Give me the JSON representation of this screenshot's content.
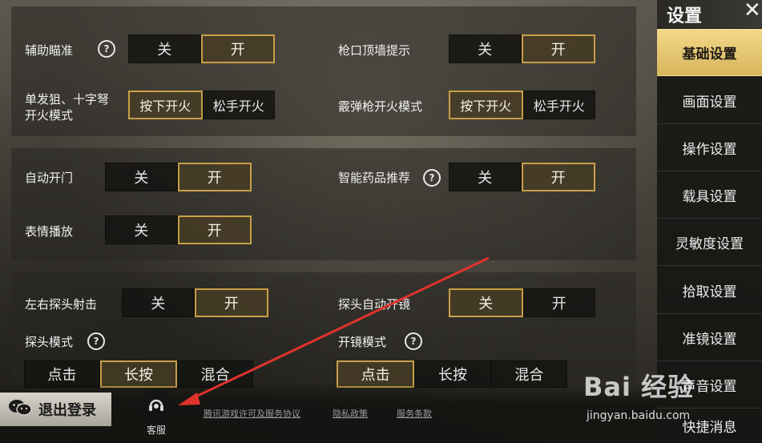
{
  "sidebar": {
    "title": "设置",
    "items": [
      {
        "label": "基础设置",
        "active": true
      },
      {
        "label": "画面设置"
      },
      {
        "label": "操作设置"
      },
      {
        "label": "载具设置"
      },
      {
        "label": "灵敏度设置"
      },
      {
        "label": "拾取设置"
      },
      {
        "label": "准镜设置"
      },
      {
        "label": "声音设置"
      },
      {
        "label": "快捷消息"
      }
    ]
  },
  "settings": {
    "assist_aim": {
      "label": "辅助瞄准",
      "help": "?",
      "options": [
        "关",
        "开"
      ],
      "selected": "开"
    },
    "muzzle_wall_hint": {
      "label": "枪口顶墙提示",
      "options": [
        "关",
        "开"
      ],
      "selected": "开"
    },
    "sniper_fire_mode": {
      "label_line1": "单发狙、十字弩",
      "label_line2": "开火模式",
      "options": [
        "按下开火",
        "松手开火"
      ],
      "selected": "按下开火"
    },
    "shotgun_fire_mode": {
      "label": "霰弹枪开火模式",
      "options": [
        "按下开火",
        "松手开火"
      ],
      "selected": "按下开火"
    },
    "auto_open_door": {
      "label": "自动开门",
      "options": [
        "关",
        "开"
      ],
      "selected": "开"
    },
    "smart_medicine": {
      "label": "智能药品推荐",
      "help": "?",
      "options": [
        "关",
        "开"
      ],
      "selected": "开"
    },
    "emote_play": {
      "label": "表情播放",
      "options": [
        "关",
        "开"
      ],
      "selected": "开"
    },
    "peek_shoot": {
      "label": "左右探头射击",
      "options": [
        "关",
        "开"
      ],
      "selected": "开"
    },
    "peek_auto_scope": {
      "label": "探头自动开镜",
      "options": [
        "关",
        "开"
      ],
      "selected": "关"
    },
    "peek_mode": {
      "label": "探头模式",
      "help": "?",
      "options": [
        "点击",
        "长按",
        "混合"
      ],
      "selected": "长按"
    },
    "scope_mode": {
      "label": "开镜模式",
      "help": "?",
      "options": [
        "点击",
        "长按",
        "混合"
      ],
      "selected": "点击"
    }
  },
  "bottom": {
    "logout_label": "退出登录",
    "customer_service_label": "客服",
    "links": [
      "腾讯游戏许可及服务协议",
      "隐私政策",
      "服务条款"
    ]
  },
  "watermark": {
    "text": "Bai 经验",
    "sub": "jingyan.baidu.com"
  },
  "colors": {
    "accent_gold": "#c7a047",
    "sidebar_active": "#e8c66f",
    "annotation_arrow": "#e0332c"
  }
}
